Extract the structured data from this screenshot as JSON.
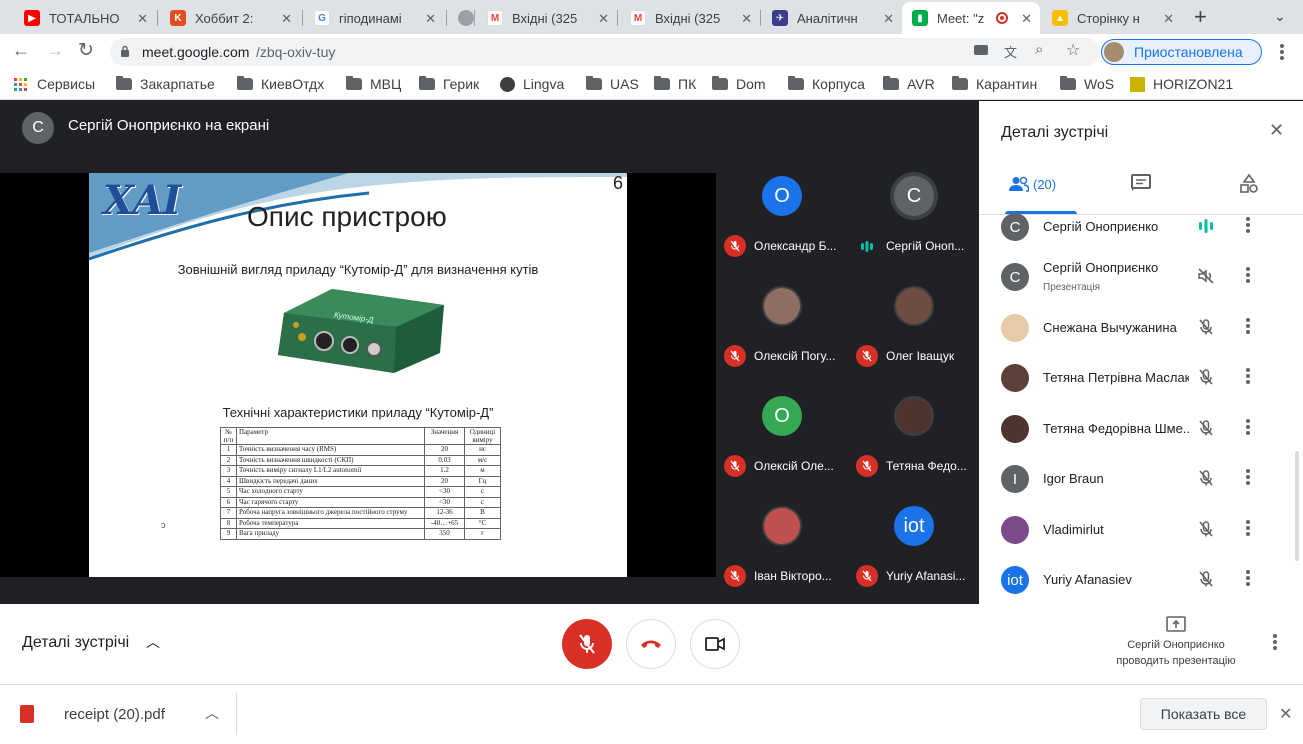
{
  "browser": {
    "tabs": [
      {
        "title": "ТОТАЛЬНО",
        "color": "#ff0000"
      },
      {
        "title": "Хоббит 2: ",
        "color": "#e04e1b"
      },
      {
        "title": "гіподинамі",
        "color": "#4285f4"
      },
      {
        "title": "",
        "color": "#9aa0a6"
      },
      {
        "title": "Вхідні (325",
        "color": "#ea4335"
      },
      {
        "title": "Вхідні (325",
        "color": "#ea4335"
      },
      {
        "title": "Аналітичн",
        "color": "#3c3c8c"
      },
      {
        "title": "Meet: \"z",
        "color": "#00ac47"
      },
      {
        "title": "Сторінку н",
        "color": "#fbbc04"
      }
    ],
    "url_host": "meet.google.com",
    "url_path": "/zbq-oxiv-tuy",
    "profile_label": "Приостановлена",
    "bookmarks": [
      {
        "label": "Сервисы"
      },
      {
        "label": "Закарпатье"
      },
      {
        "label": "КиевОтдх"
      },
      {
        "label": "МВЦ"
      },
      {
        "label": "Герик"
      },
      {
        "label": "Lingva"
      },
      {
        "label": "UAS"
      },
      {
        "label": "ПК"
      },
      {
        "label": "Dom"
      },
      {
        "label": "Корпуса"
      },
      {
        "label": "AVR"
      },
      {
        "label": "Карантин"
      },
      {
        "label": "WoS"
      },
      {
        "label": "HORIZON21"
      }
    ]
  },
  "presenter": {
    "initial": "С",
    "label": "Сергій Оноприєнко на екрані"
  },
  "slide": {
    "number": "6",
    "logo_text": "ХАІ",
    "title": "Опис пристрою",
    "subtitle": "Зовнішній вигляд приладу “Кутомір-Д” для визначення кутів",
    "device_label": "Кутомір-Д",
    "table_title": "Технічні характеристики приладу “Кутомір-Д”",
    "table_header": [
      "№ п/п",
      "Параметр",
      "Значення",
      "Одиниці виміру"
    ],
    "table_rows": [
      [
        "1",
        "Точність визначення часу (RMS)",
        "20",
        "нс"
      ],
      [
        "2",
        "Точність визначення швидкості (СКП)",
        "0.03",
        "м/с"
      ],
      [
        "3",
        "Точність виміру сигналу L1/L2 autonomії",
        "1.2",
        "м"
      ],
      [
        "4",
        "Швидкість передачі даних",
        "20",
        "Гц"
      ],
      [
        "5",
        "Час холодного старту",
        "<30",
        "с"
      ],
      [
        "6",
        "Час гарячого старту",
        "<30",
        "с"
      ],
      [
        "7",
        "Робоча напруга зовнішнього джерела постійного струму",
        "12-36",
        "В"
      ],
      [
        "8",
        "Робоча температура",
        "-40…+65",
        "°С"
      ],
      [
        "9",
        "Вага приладу",
        "350",
        "г"
      ]
    ]
  },
  "tiles": [
    {
      "initial": "О",
      "name": "Олександр Б...",
      "color": "#1a73e8",
      "muted": true
    },
    {
      "initial": "С",
      "name": "Сергій Оноп...",
      "color": "#5f6368",
      "muted": false
    },
    {
      "initial": "",
      "name": "Олексій Погу...",
      "color": "#8d6e63",
      "muted": true
    },
    {
      "initial": "",
      "name": "Олег Іващук",
      "color": "#6d4c41",
      "muted": true
    },
    {
      "initial": "О",
      "name": "Олексій Оле...",
      "color": "#34a853",
      "muted": true
    },
    {
      "initial": "",
      "name": "Тетяна Федо...",
      "color": "#4e342e",
      "muted": true
    },
    {
      "initial": "",
      "name": "Іван Вікторо...",
      "color": "#c0504d",
      "muted": true
    },
    {
      "initial": "iot",
      "name": "Yuriy Afanasi...",
      "color": "#1a73e8",
      "muted": true
    }
  ],
  "panel": {
    "title": "Деталі зустрічі",
    "people_count": "(20)",
    "participants": [
      {
        "initial": "С",
        "name": "Сергій Оноприєнко",
        "sub": "",
        "color": "#5f6368",
        "state": "speaking"
      },
      {
        "initial": "С",
        "name": "Сергій Оноприєнко",
        "sub": "Презентація",
        "color": "#5f6368",
        "state": "muted-audio"
      },
      {
        "initial": "",
        "name": "Снежана Вычужанина",
        "sub": "",
        "color": "#e8c9a8",
        "state": "muted"
      },
      {
        "initial": "",
        "name": "Тетяна Петрівна Маслак",
        "sub": "",
        "color": "#5d4037",
        "state": "muted"
      },
      {
        "initial": "",
        "name": "Тетяна Федорівна Шме...",
        "sub": "",
        "color": "#4e342e",
        "state": "muted"
      },
      {
        "initial": "I",
        "name": "Igor Braun",
        "sub": "",
        "color": "#5f6368",
        "state": "muted"
      },
      {
        "initial": "",
        "name": "Vladimirlut",
        "sub": "",
        "color": "#7b4a8b",
        "state": "muted"
      },
      {
        "initial": "iot",
        "name": "Yuriy Afanasiev",
        "sub": "",
        "color": "#1a73e8",
        "state": "muted"
      }
    ]
  },
  "bottom_bar": {
    "details_label": "Деталі зустрічі",
    "presenting_line1": "Сергій Оноприєнко",
    "presenting_line2": "проводить презентацію"
  },
  "download": {
    "file": "receipt (20).pdf",
    "show_all": "Показать все"
  },
  "colors": {
    "red": "#ea4335",
    "meet_green": "#00897b",
    "dark": "#202124"
  }
}
